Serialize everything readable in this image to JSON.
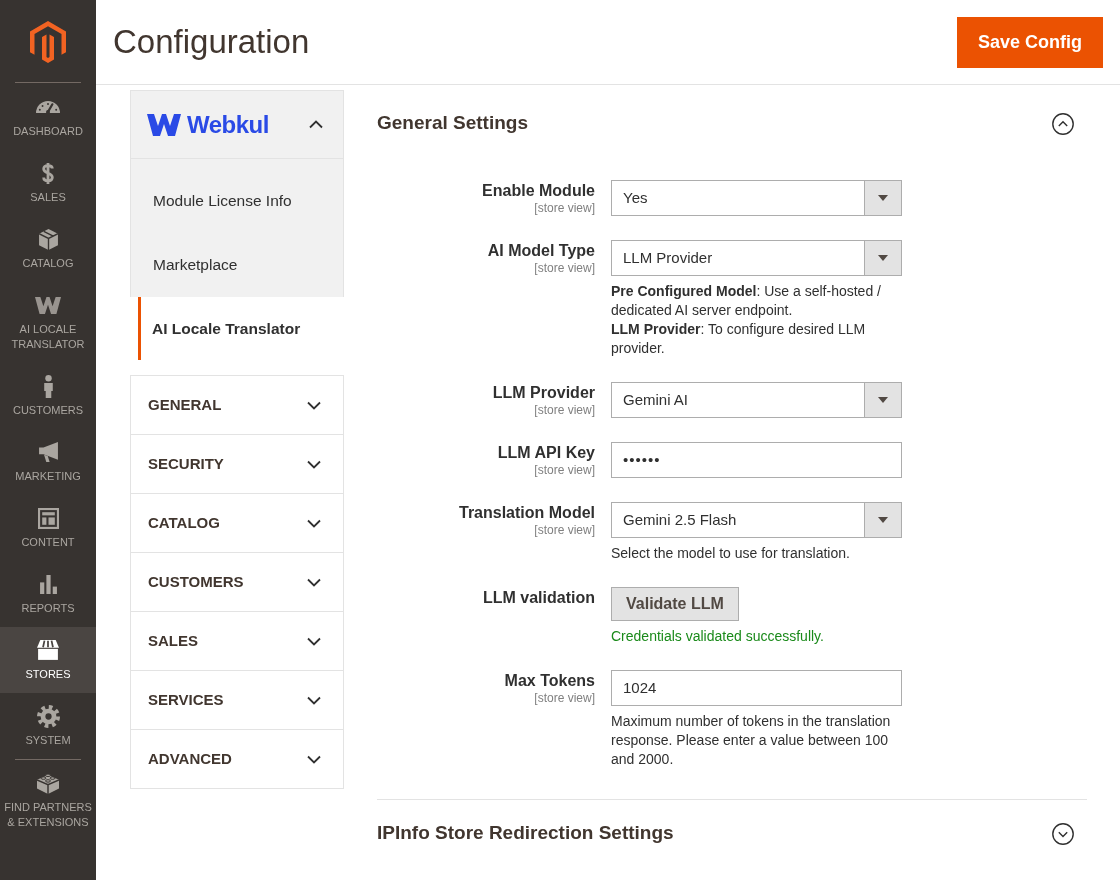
{
  "sidebar": {
    "items": [
      {
        "label": "DASHBOARD",
        "selected": false
      },
      {
        "label": "SALES",
        "selected": false
      },
      {
        "label": "CATALOG",
        "selected": false
      },
      {
        "label": "AI LOCALE TRANSLATOR",
        "selected": false
      },
      {
        "label": "CUSTOMERS",
        "selected": false
      },
      {
        "label": "MARKETING",
        "selected": false
      },
      {
        "label": "CONTENT",
        "selected": false
      },
      {
        "label": "REPORTS",
        "selected": false
      },
      {
        "label": "STORES",
        "selected": true
      },
      {
        "label": "SYSTEM",
        "selected": false
      },
      {
        "label": "FIND PARTNERS & EXTENSIONS",
        "selected": false
      }
    ]
  },
  "page_header": {
    "title": "Configuration",
    "save_button": "Save Config"
  },
  "config_nav": {
    "vendor": {
      "name": "Webkul",
      "expanded": true,
      "items": [
        {
          "label": "Module License Info",
          "selected": false
        },
        {
          "label": "Marketplace",
          "selected": false
        },
        {
          "label": "AI Locale Translator",
          "selected": true
        }
      ]
    },
    "sections": [
      {
        "label": "GENERAL",
        "expanded": false
      },
      {
        "label": "SECURITY",
        "expanded": false
      },
      {
        "label": "CATALOG",
        "expanded": false
      },
      {
        "label": "CUSTOMERS",
        "expanded": false
      },
      {
        "label": "SALES",
        "expanded": false
      },
      {
        "label": "SERVICES",
        "expanded": false
      },
      {
        "label": "ADVANCED",
        "expanded": false
      }
    ]
  },
  "settings": [
    {
      "title": "General Settings",
      "expanded": true,
      "fields": [
        {
          "kind": "select",
          "label": "Enable Module",
          "scope": "[store view]",
          "value": "Yes"
        },
        {
          "kind": "select",
          "label": "AI Model Type",
          "scope": "[store view]",
          "value": "LLM Provider",
          "notes": [
            "**Pre Configured Model**: Use a self-hosted / dedicated AI server endpoint.",
            "**LLM Provider**: To configure desired LLM provider."
          ]
        },
        {
          "kind": "select",
          "label": "LLM Provider",
          "scope": "[store view]",
          "value": "Gemini AI"
        },
        {
          "kind": "password",
          "label": "LLM API Key",
          "scope": "[store view]",
          "value": "••••••"
        },
        {
          "kind": "select",
          "label": "Translation Model",
          "scope": "[store view]",
          "value": "Gemini 2.5 Flash",
          "notes": [
            "Select the model to use for translation."
          ]
        },
        {
          "kind": "button",
          "label": "LLM validation",
          "button": "Validate LLM",
          "message": {
            "text": "Credentials validated successfully.",
            "kind": "success"
          }
        },
        {
          "kind": "text",
          "label": "Max Tokens",
          "scope": "[store view]",
          "value": "1024",
          "notes": [
            "Maximum number of tokens in the translation response. Please enter a value between 100 and 2000."
          ]
        }
      ]
    },
    {
      "title": "IPInfo Store Redirection Settings",
      "expanded": false
    }
  ]
}
